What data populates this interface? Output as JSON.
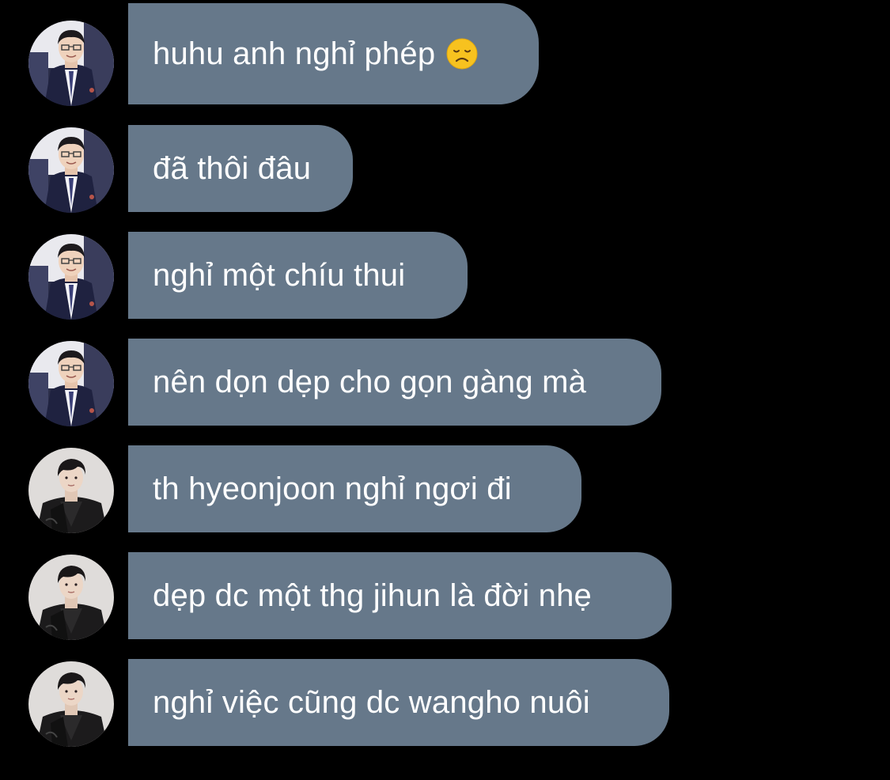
{
  "messages": [
    {
      "text": "huhu anh nghỉ phép",
      "emoji": "disappointed-face",
      "avatar": "suit-man"
    },
    {
      "text": "đã thôi đâu",
      "avatar": "suit-man"
    },
    {
      "text": "nghỉ một chíu thui",
      "avatar": "suit-man"
    },
    {
      "text": "nên dọn dẹp cho gọn gàng mà",
      "avatar": "suit-man"
    },
    {
      "text": "th hyeonjoon nghỉ ngơi đi",
      "avatar": "black-jacket-man"
    },
    {
      "text": "dẹp dc một thg jihun là đời nhẹ",
      "avatar": "black-jacket-man"
    },
    {
      "text": "nghỉ việc cũng dc wangho nuôi",
      "avatar": "black-jacket-man"
    }
  ],
  "colors": {
    "background": "#000000",
    "bubble": "#66788a",
    "text": "#ffffff"
  }
}
